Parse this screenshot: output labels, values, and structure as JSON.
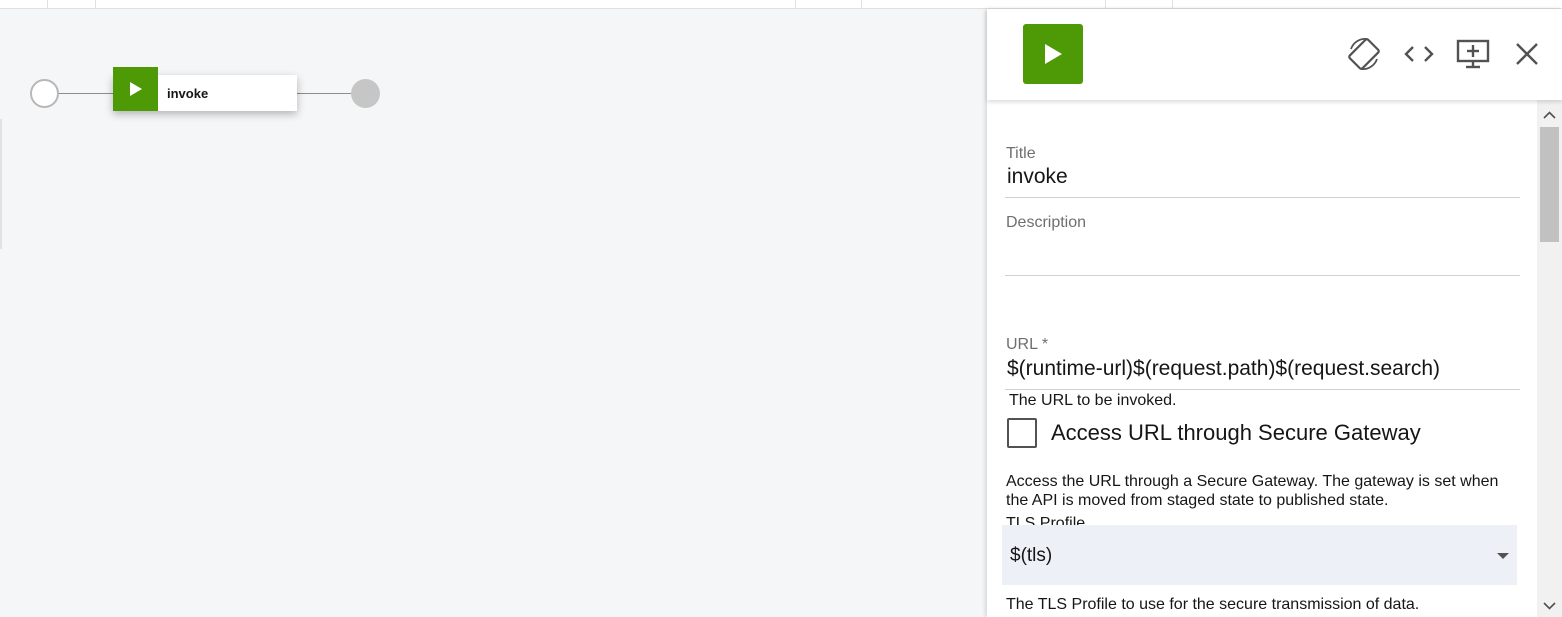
{
  "flow": {
    "node_label": "invoke"
  },
  "panel": {
    "title_label": "Title",
    "title_value": "invoke",
    "description_label": "Description",
    "description_value": "",
    "url_label": "URL *",
    "url_value": "$(runtime-url)$(request.path)$(request.search)",
    "url_help": "The URL to be invoked.",
    "secure_gateway_label": "Access URL through Secure Gateway",
    "secure_gateway_checked": false,
    "secure_gateway_help": "Access the URL through a Secure Gateway. The gateway is set when the API is moved from staged state to published state.",
    "tls_label": "TLS Profile",
    "tls_value": "$(tls)",
    "tls_help": "The TLS Profile to use for the secure transmission of data."
  },
  "icons": {
    "header_play": "play-icon",
    "rotate": "rotate-icon",
    "code": "code-icon",
    "add_screen": "add-screen-icon",
    "close": "close-icon"
  },
  "colors": {
    "accent_green": "#4e9a06",
    "canvas_bg": "#f5f6f8",
    "select_bg": "#edf0f6"
  }
}
